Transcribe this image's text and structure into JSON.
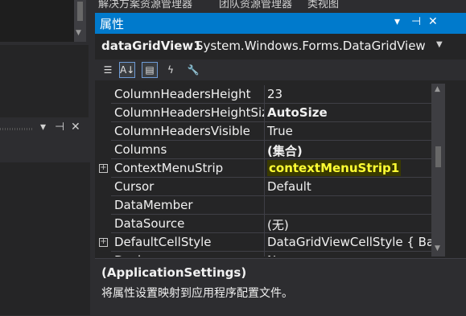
{
  "top_tabs": [
    "解决方案资源管理器",
    "团队资源管理器",
    "类视图"
  ],
  "left_panel": {
    "pin": "▾ ⊣ ✕"
  },
  "properties": {
    "title": "属性",
    "title_controls": {
      "dropdown": "▾",
      "pin": "⊣",
      "close": "✕"
    },
    "object_name": "dataGridView1",
    "object_type": "System.Windows.Forms.DataGridView",
    "toolbar": [
      {
        "name": "categorized-icon",
        "glyph": "☰"
      },
      {
        "name": "alphabetical-icon",
        "glyph": "A↓"
      },
      {
        "name": "properties-icon",
        "glyph": "▤"
      },
      {
        "name": "events-icon",
        "glyph": "ϟ"
      },
      {
        "name": "property-pages-icon",
        "glyph": "🔧"
      }
    ],
    "rows": [
      {
        "name": "ColumnHeadersHeight",
        "value": "23",
        "bold": false,
        "expandable": false
      },
      {
        "name": "ColumnHeadersHeightSizeMode",
        "value": "AutoSize",
        "bold": true,
        "expandable": false
      },
      {
        "name": "ColumnHeadersVisible",
        "value": "True",
        "bold": false,
        "expandable": false
      },
      {
        "name": "Columns",
        "value": "(集合)",
        "bold": true,
        "expandable": false
      },
      {
        "name": "ContextMenuStrip",
        "value": "contextMenuStrip1",
        "bold": true,
        "expandable": true,
        "highlight": true
      },
      {
        "name": "Cursor",
        "value": "Default",
        "bold": false,
        "expandable": false
      },
      {
        "name": "DataMember",
        "value": "",
        "bold": false,
        "expandable": false
      },
      {
        "name": "DataSource",
        "value": "(无)",
        "bold": false,
        "expandable": false
      },
      {
        "name": "DefaultCellStyle",
        "value": "DataGridViewCellStyle { BackColor",
        "bold": false,
        "expandable": true
      },
      {
        "name": "Dock",
        "value": "None",
        "bold": false,
        "expandable": false
      }
    ],
    "description": {
      "title": "(ApplicationSettings)",
      "text": "将属性设置映射到应用程序配置文件。"
    }
  },
  "colors": {
    "accent": "#007acc",
    "highlight": "#ffff33"
  }
}
